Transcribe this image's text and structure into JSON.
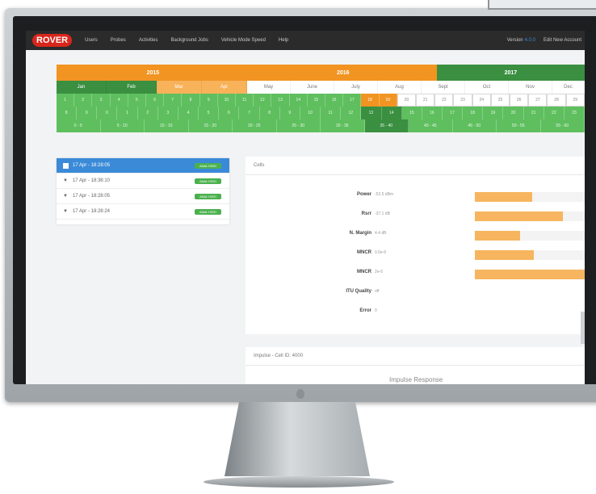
{
  "navbar": {
    "logo": "ROVER",
    "items": [
      "Users",
      "Probes",
      "Activities",
      "Background Jobs",
      "Vehicle Mode Speed",
      "Help"
    ],
    "version_label": "Version",
    "version_value": "4.0.0",
    "right_link": "Edit New Account"
  },
  "timeline": {
    "years": [
      {
        "label": "2015",
        "color": "#f29422"
      },
      {
        "label": "2016",
        "color": "#f29422"
      },
      {
        "label": "2017",
        "color": "#3a8f40"
      }
    ],
    "months": [
      {
        "label": "Jan",
        "style": "dark"
      },
      {
        "label": "Feb",
        "style": "dark"
      },
      {
        "label": "Mar",
        "style": "orange"
      },
      {
        "label": "Apr",
        "style": "orange"
      },
      {
        "label": "May",
        "style": "white"
      },
      {
        "label": "June",
        "style": "white"
      },
      {
        "label": "July",
        "style": "white"
      },
      {
        "label": "Aug",
        "style": "white"
      },
      {
        "label": "Sept",
        "style": "white"
      },
      {
        "label": "Oct",
        "style": "white"
      },
      {
        "label": "Nov",
        "style": "white"
      },
      {
        "label": "Dec",
        "style": "white"
      }
    ],
    "days": [
      "1",
      "2",
      "3",
      "4",
      "5",
      "6",
      "7",
      "8",
      "9",
      "10",
      "11",
      "12",
      "13",
      "14",
      "15",
      "16",
      "17",
      "18",
      "19",
      "20",
      "21",
      "22",
      "23",
      "24",
      "25",
      "26",
      "27",
      "28",
      "29"
    ],
    "hours": [
      "8",
      "9",
      "0",
      "1",
      "2",
      "3",
      "4",
      "5",
      "6",
      "7",
      "8",
      "9",
      "10",
      "11",
      "12",
      "13",
      "14",
      "15",
      "16",
      "17",
      "18",
      "19",
      "20",
      "21",
      "22",
      "23"
    ],
    "ranges": [
      "0 - 5",
      "5 - 10",
      "10 - 15",
      "15 - 20",
      "20 - 25",
      "25 - 30",
      "30 - 35",
      "35 - 40",
      "40 - 45",
      "45 - 50",
      "50 - 55",
      "55 - 60"
    ]
  },
  "sessions": [
    {
      "label": "17 Apr - 18:28:05",
      "badge": "ANALYSED",
      "active": true
    },
    {
      "label": "17 Apr - 18:38:10",
      "badge": "ANALYSED",
      "active": false
    },
    {
      "label": "17 Apr - 18:28:05",
      "badge": "ANALYSED",
      "active": false
    },
    {
      "label": "17 Apr - 18:28:24",
      "badge": "ANALYSED",
      "active": false
    }
  ],
  "cells": {
    "title": "Cells",
    "metrics": [
      {
        "label": "Power",
        "value": "-52.5 dBm",
        "fill": 0.52
      },
      {
        "label": "Rsrr",
        "value": "-37.1 dB",
        "fill": 0.8
      },
      {
        "label": "N. Margin",
        "value": "4.4 dB",
        "fill": 0.41
      },
      {
        "label": "MNCR",
        "value": "0.0e-6",
        "fill": 0.54
      },
      {
        "label": "MNCR",
        "value": "2e-6",
        "fill": 1.0
      },
      {
        "label": "ITU Quality",
        "value": "off",
        "fill": null
      },
      {
        "label": "Error",
        "value": "0",
        "fill": null
      }
    ]
  },
  "impulse": {
    "header": "Impulse - Cell ID: 4000",
    "title": "Impulse Response"
  }
}
